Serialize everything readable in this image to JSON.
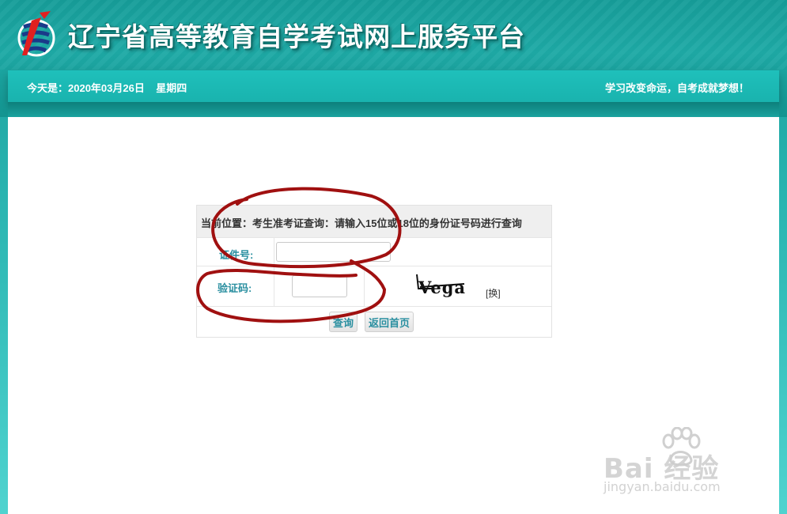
{
  "header": {
    "site_title": "辽宁省高等教育自学考试网上服务平台",
    "date_text": "今天是：2020年03月26日    星期四",
    "slogan": "学习改变命运，自考成就梦想！"
  },
  "query_form": {
    "breadcrumb": "当前位置：考生准考证查询：请输入15位或18位的身份证号码进行查询",
    "id_label": "证件号:",
    "id_value": "",
    "captcha_label": "验证码:",
    "captcha_value": "",
    "captcha_text": "Vega",
    "refresh_label": "[换]",
    "query_button": "查询",
    "home_button": "返回首页"
  },
  "watermark": {
    "brand": "Bai  经验",
    "site": "jingyan.baidu.com"
  },
  "colors": {
    "header_teal": "#1aa39f",
    "label_teal": "#2a8fa0",
    "annotation_red": "#a01010"
  },
  "icons": [
    "logo-icon",
    "baidu-paw-icon"
  ]
}
